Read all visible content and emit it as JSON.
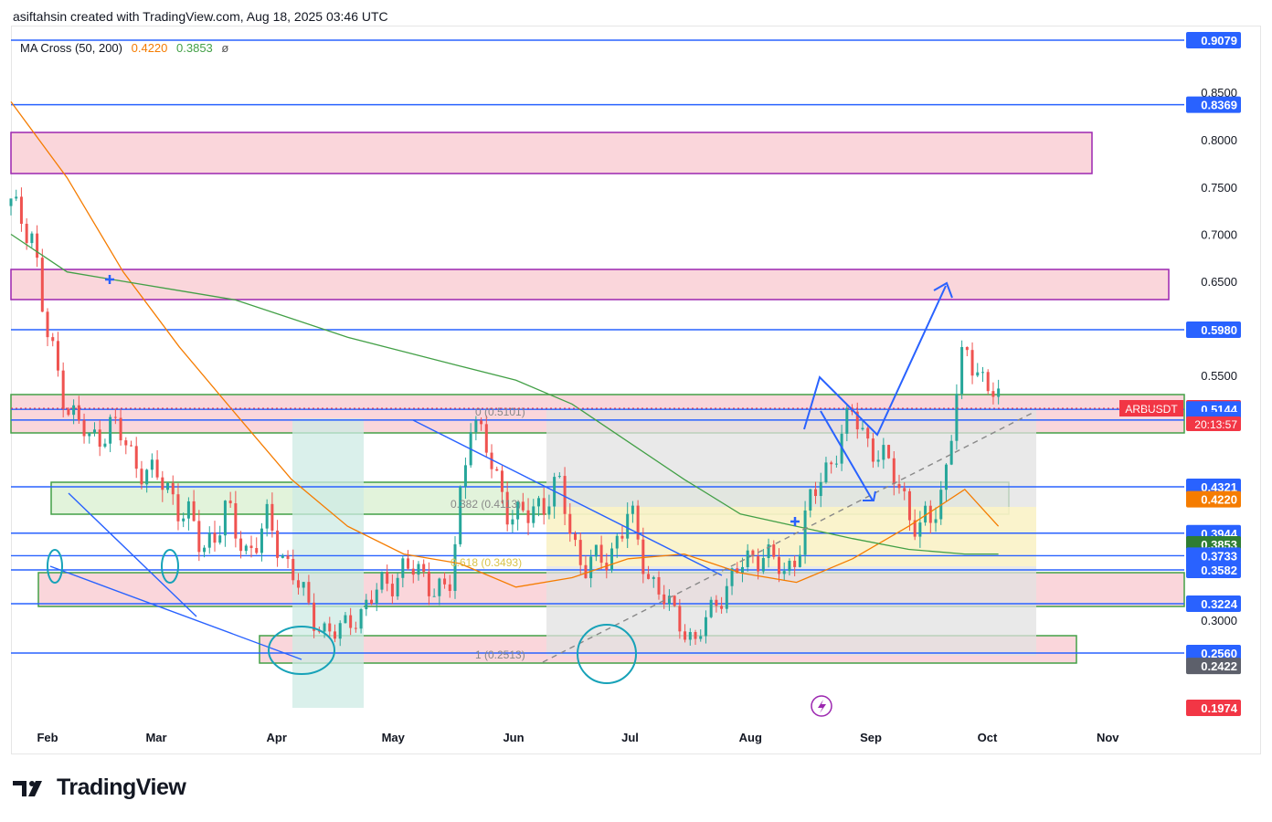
{
  "header": {
    "title": "asiftahsin created with TradingView.com, Aug 18, 2025 03:46 UTC"
  },
  "indicator": {
    "name": "MA Cross (50, 200)",
    "ma50": "0.4220",
    "ma200": "0.3853",
    "symbol": "ø"
  },
  "footer": {
    "brand": "TradingView"
  },
  "colors": {
    "up": "#26a69a",
    "down": "#ef5350",
    "ma50": "#f57c00",
    "ma200": "#43a047",
    "hline": "#2962ff",
    "zone_pink": "#f8c8cf",
    "zone_green": "#d8efcf",
    "zone_grey": "#e2e2e2",
    "zone_yellow": "#fff5c2",
    "projection": "#2962ff",
    "badge_red": "#f23645",
    "badge_grey": "#5d606b"
  },
  "chart_data": {
    "type": "line",
    "symbol": "ARBUSDT",
    "countdown": "20:13:57",
    "last_price": 0.5156,
    "x_axis_labels": [
      "Feb",
      "Mar",
      "Apr",
      "May",
      "Jun",
      "Jul",
      "Aug",
      "Sep",
      "Oct",
      "Nov"
    ],
    "y_axis_ticks": [
      "0.8500",
      "0.8000",
      "0.7500",
      "0.7000",
      "0.6500",
      "0.5500",
      "0.3000"
    ],
    "y_range": [
      0.19,
      0.93
    ],
    "price_levels": [
      {
        "label": "0.9079",
        "value": 0.9079,
        "style": "blue"
      },
      {
        "label": "0.8369",
        "value": 0.8369,
        "style": "blue"
      },
      {
        "label": "0.5980",
        "value": 0.598,
        "style": "blue"
      },
      {
        "label": "0.5156",
        "value": 0.5156,
        "style": "red"
      },
      {
        "label": "0.5144",
        "value": 0.5144,
        "style": "blue"
      },
      {
        "label": "0.5031",
        "value": 0.5031,
        "style": "blue"
      },
      {
        "label": "0.4321",
        "value": 0.4321,
        "style": "blue"
      },
      {
        "label": "0.4220",
        "value": 0.422,
        "style": "orange"
      },
      {
        "label": "0.3944",
        "value": 0.3944,
        "style": "blue"
      },
      {
        "label": "0.3853",
        "value": 0.3853,
        "style": "green"
      },
      {
        "label": "0.3733",
        "value": 0.3733,
        "style": "blue"
      },
      {
        "label": "0.3582",
        "value": 0.3582,
        "style": "blue"
      },
      {
        "label": "0.3224",
        "value": 0.3224,
        "style": "blue"
      },
      {
        "label": "0.2560",
        "value": 0.256,
        "style": "blue"
      },
      {
        "label": "0.2422",
        "value": 0.2422,
        "style": "grey"
      },
      {
        "label": "0.1974",
        "value": 0.1974,
        "style": "red"
      }
    ],
    "fib_labels": [
      "0 (0.5101)",
      "0.382 (0.4113)",
      "0.618 (0.3493)",
      "1 (0.2513)"
    ],
    "series": [
      {
        "name": "MA Cross (50, 200)",
        "x": [
          0.0,
          0.05,
          0.1,
          0.15,
          0.2,
          0.25,
          0.3,
          0.35,
          0.4,
          0.45,
          0.5,
          0.55,
          0.6,
          0.65,
          0.7,
          0.75,
          0.8,
          0.85,
          0.88
        ],
        "values": [
          0.84,
          0.76,
          0.66,
          0.58,
          0.51,
          0.44,
          0.4,
          0.375,
          0.365,
          0.34,
          0.35,
          0.37,
          0.375,
          0.355,
          0.345,
          0.37,
          0.4,
          0.43,
          0.4
        ]
      },
      {
        "name": "MA 200",
        "x": [
          0.0,
          0.05,
          0.1,
          0.15,
          0.2,
          0.25,
          0.3,
          0.35,
          0.4,
          0.45,
          0.5,
          0.55,
          0.6,
          0.65,
          0.7,
          0.75,
          0.8,
          0.85,
          0.88
        ],
        "values": [
          0.7,
          0.66,
          0.65,
          0.64,
          0.63,
          0.61,
          0.59,
          0.575,
          0.56,
          0.545,
          0.52,
          0.48,
          0.44,
          0.41,
          0.4,
          0.39,
          0.38,
          0.375,
          0.375
        ]
      },
      {
        "name": "ARBUSDT",
        "x": [
          0.0,
          0.02,
          0.03,
          0.05,
          0.07,
          0.09,
          0.11,
          0.13,
          0.15,
          0.17,
          0.19,
          0.21,
          0.23,
          0.25,
          0.27,
          0.29,
          0.31,
          0.33,
          0.35,
          0.37,
          0.39,
          0.41,
          0.43,
          0.45,
          0.47,
          0.49,
          0.51,
          0.53,
          0.55,
          0.57,
          0.59,
          0.61,
          0.63,
          0.65,
          0.67,
          0.69,
          0.71,
          0.73,
          0.75,
          0.77,
          0.79,
          0.81,
          0.83,
          0.85,
          0.87,
          0.88
        ],
        "values": [
          0.73,
          0.7,
          0.6,
          0.52,
          0.48,
          0.5,
          0.46,
          0.44,
          0.42,
          0.38,
          0.41,
          0.38,
          0.4,
          0.36,
          0.3,
          0.28,
          0.31,
          0.34,
          0.36,
          0.35,
          0.33,
          0.51,
          0.45,
          0.4,
          0.42,
          0.43,
          0.36,
          0.37,
          0.41,
          0.35,
          0.31,
          0.27,
          0.33,
          0.36,
          0.38,
          0.35,
          0.41,
          0.46,
          0.51,
          0.47,
          0.44,
          0.39,
          0.43,
          0.58,
          0.54,
          0.52
        ]
      }
    ],
    "projection_path": [
      {
        "x": "Aug 18",
        "y": 0.5156
      },
      {
        "x": "Aug 19",
        "y": 0.546
      },
      {
        "x": "Aug 20",
        "y": 0.518
      },
      {
        "x": "Sep 1",
        "y": 0.48
      },
      {
        "x": "Sep 15",
        "y": 0.63
      }
    ]
  }
}
